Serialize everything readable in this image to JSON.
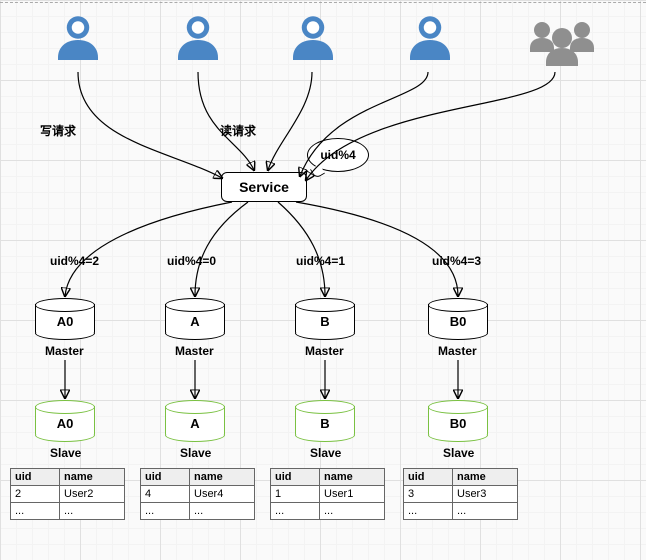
{
  "labels": {
    "write_request": "写请求",
    "read_request": "读请求",
    "service": "Service",
    "bubble": "uid%4",
    "master": "Master",
    "slave": "Slave"
  },
  "routes": [
    {
      "rule": "uid%4=2",
      "name": "A0"
    },
    {
      "rule": "uid%4=0",
      "name": "A"
    },
    {
      "rule": "uid%4=1",
      "name": "B"
    },
    {
      "rule": "uid%4=3",
      "name": "B0"
    }
  ],
  "table": {
    "cols": [
      "uid",
      "name"
    ],
    "ellipsis": "...",
    "data": [
      [
        {
          "uid": "2",
          "name": "User2"
        }
      ],
      [
        {
          "uid": "4",
          "name": "User4"
        }
      ],
      [
        {
          "uid": "1",
          "name": "User1"
        }
      ],
      [
        {
          "uid": "3",
          "name": "User3"
        }
      ]
    ]
  }
}
